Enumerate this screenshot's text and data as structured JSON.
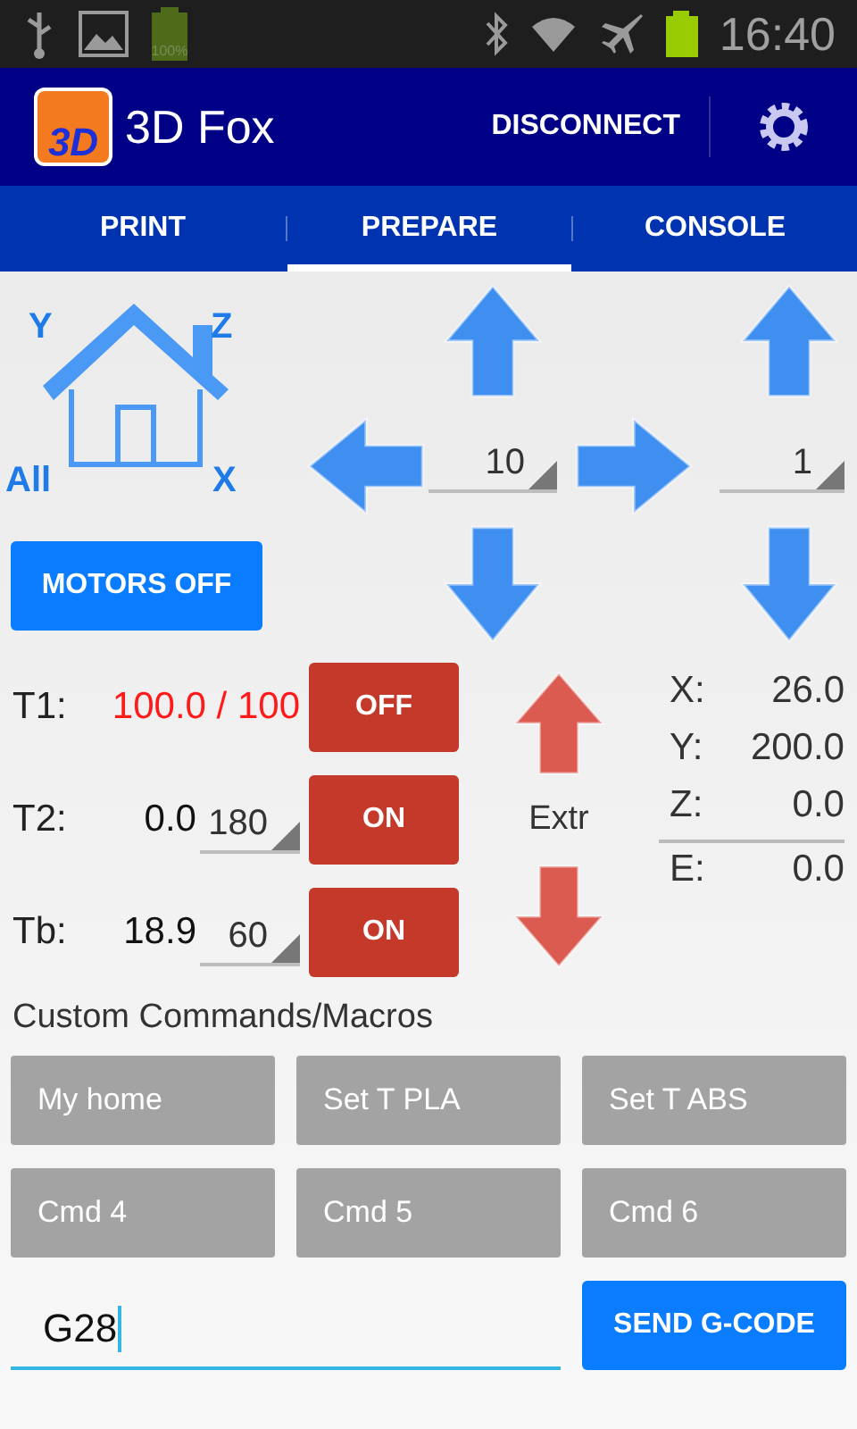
{
  "status_bar": {
    "battery_label": "100%",
    "time": "16:40"
  },
  "app_bar": {
    "title": "3D Fox",
    "logo_text": "3D",
    "action": "DISCONNECT"
  },
  "tabs": [
    {
      "label": "PRINT",
      "selected": false
    },
    {
      "label": "PREPARE",
      "selected": true
    },
    {
      "label": "CONSOLE",
      "selected": false
    }
  ],
  "home": {
    "labels": [
      "Y",
      "Z",
      "All",
      "X"
    ]
  },
  "xy_step": "10",
  "z_step": "1",
  "motors_button": "MOTORS OFF",
  "heaters": [
    {
      "label": "T1:",
      "reading": "100.0 / 100",
      "heating": true,
      "button": "OFF"
    },
    {
      "label": "T2:",
      "reading": "0.0",
      "heating": false,
      "setpoint": "180",
      "button": "ON"
    },
    {
      "label": "Tb:",
      "reading": "18.9",
      "heating": false,
      "setpoint": "60",
      "button": "ON"
    }
  ],
  "extruder_label": "Extr",
  "positions": [
    {
      "axis": "X:",
      "value": "26.0"
    },
    {
      "axis": "Y:",
      "value": "200.0"
    },
    {
      "axis": "Z:",
      "value": "0.0"
    },
    {
      "axis": "E:",
      "value": "0.0"
    }
  ],
  "macros_title": "Custom Commands/Macros",
  "macros": [
    "My home",
    "Set T PLA",
    "Set T ABS",
    "Cmd 4",
    "Cmd 5",
    "Cmd 6"
  ],
  "gcode": {
    "value": "G28",
    "button": "SEND G-CODE"
  }
}
